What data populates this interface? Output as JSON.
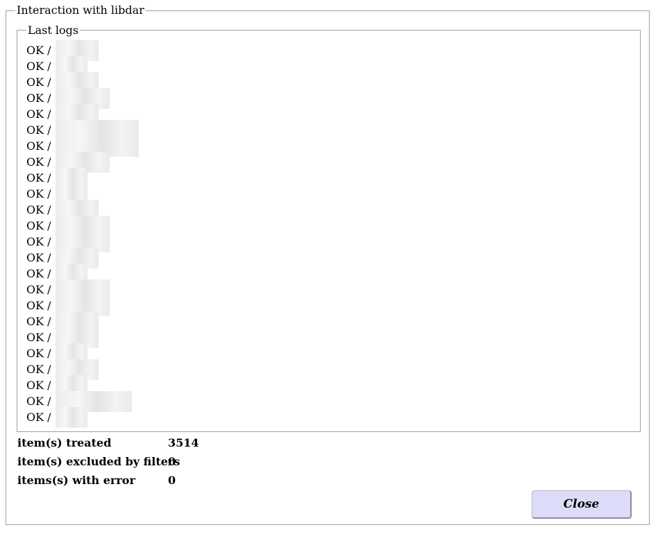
{
  "outer_panel": {
    "title": "Interaction with libdar"
  },
  "logs_panel": {
    "title": "Last logs",
    "lines": [
      {
        "status": "OK /",
        "redact_w": 62
      },
      {
        "status": "OK /",
        "redact_w": 46
      },
      {
        "status": "OK /",
        "redact_w": 62
      },
      {
        "status": "OK /",
        "redact_w": 78
      },
      {
        "status": "OK /",
        "redact_w": 62
      },
      {
        "status": "OK /",
        "redact_w": 120
      },
      {
        "status": "OK /",
        "redact_w": 120
      },
      {
        "status": "OK /",
        "redact_w": 78
      },
      {
        "status": "OK /",
        "redact_w": 46
      },
      {
        "status": "OK /",
        "redact_w": 46
      },
      {
        "status": "OK /",
        "redact_w": 62
      },
      {
        "status": "OK /",
        "redact_w": 78
      },
      {
        "status": "OK /",
        "redact_w": 78
      },
      {
        "status": "OK /",
        "redact_w": 62
      },
      {
        "status": "OK /",
        "redact_w": 46
      },
      {
        "status": "OK /",
        "redact_w": 78
      },
      {
        "status": "OK /",
        "redact_w": 78
      },
      {
        "status": "OK /",
        "redact_w": 62
      },
      {
        "status": "OK /",
        "redact_w": 62
      },
      {
        "status": "OK /",
        "redact_w": 46
      },
      {
        "status": "OK /",
        "redact_w": 62
      },
      {
        "status": "OK /",
        "redact_w": 46
      },
      {
        "status": "OK /",
        "redact_w": 110
      },
      {
        "status": "OK /",
        "redact_w": 46
      }
    ]
  },
  "stats": {
    "treated_label": "item(s) treated",
    "treated_value": "3514",
    "excluded_label": "item(s) excluded by filters",
    "excluded_value": "0",
    "errors_label": "items(s) with error",
    "errors_value": "0"
  },
  "actions": {
    "close_label": "Close"
  },
  "colors": {
    "close_button_bg": "#dcdcf8",
    "border": "#a0a0a0"
  }
}
